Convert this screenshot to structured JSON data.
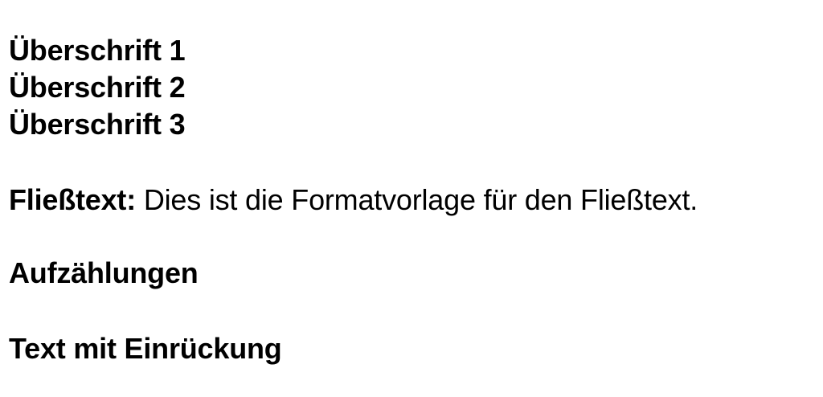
{
  "headings": {
    "h1": "Überschrift 1",
    "h2": "Überschrift 2",
    "h3": "Überschrift 3"
  },
  "body_style": {
    "label": "Fließtext:",
    "text": " Dies ist die Formatvorlage für den Fließtext."
  },
  "list_style": "Aufzählungen",
  "indent_style": "Text mit Einrückung"
}
